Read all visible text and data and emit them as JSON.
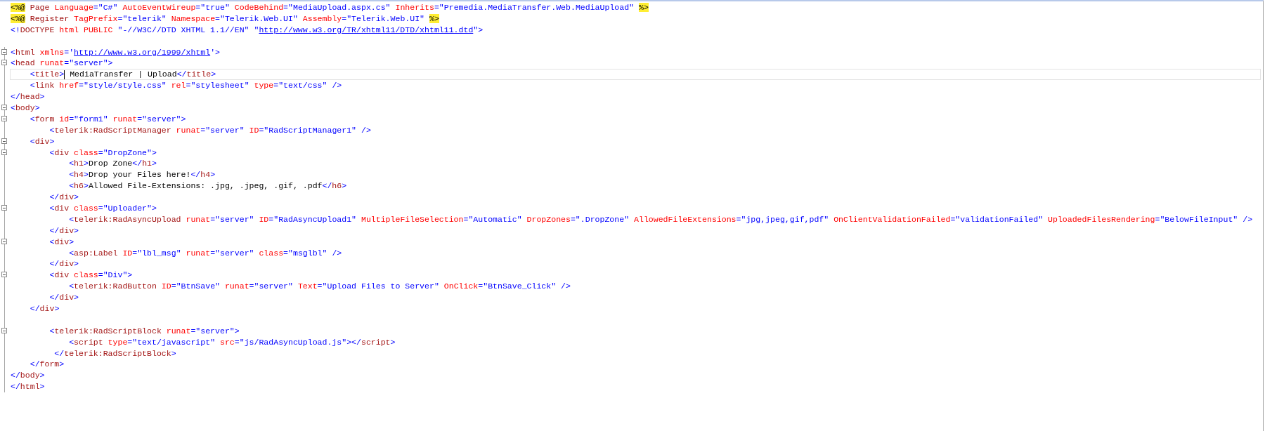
{
  "editor": {
    "lines": [
      {
        "in_block": false,
        "collapsible": false,
        "tokens": [
          {
            "kind": "directive",
            "text": "<%@"
          },
          {
            "kind": "tag",
            "text": " Page"
          },
          {
            "kind": "attr",
            "text": " Language"
          },
          {
            "kind": "value",
            "text": "=\"C#\""
          },
          {
            "kind": "attr",
            "text": " AutoEventWireup"
          },
          {
            "kind": "value",
            "text": "=\"true\""
          },
          {
            "kind": "attr",
            "text": " CodeBehind"
          },
          {
            "kind": "value",
            "text": "=\"MediaUpload.aspx.cs\""
          },
          {
            "kind": "attr",
            "text": " Inherits"
          },
          {
            "kind": "value",
            "text": "=\"Premedia.MediaTransfer.Web.MediaUpload\" "
          },
          {
            "kind": "directive",
            "text": "%>"
          }
        ]
      },
      {
        "in_block": false,
        "collapsible": false,
        "tokens": [
          {
            "kind": "directive",
            "text": "<%@"
          },
          {
            "kind": "tag",
            "text": " Register"
          },
          {
            "kind": "attr",
            "text": " TagPrefix"
          },
          {
            "kind": "value",
            "text": "=\"telerik\""
          },
          {
            "kind": "attr",
            "text": " Namespace"
          },
          {
            "kind": "value",
            "text": "=\"Telerik.Web.UI\""
          },
          {
            "kind": "attr",
            "text": " Assembly"
          },
          {
            "kind": "value",
            "text": "=\"Telerik.Web.UI\" "
          },
          {
            "kind": "directive",
            "text": "%>"
          }
        ]
      },
      {
        "in_block": false,
        "collapsible": false,
        "tokens": [
          {
            "kind": "delim",
            "text": "<!"
          },
          {
            "kind": "tag",
            "text": "DOCTYPE"
          },
          {
            "kind": "attr",
            "text": " html PUBLIC"
          },
          {
            "kind": "value",
            "text": " \"-//W3C//DTD XHTML 1.1//EN\" \""
          },
          {
            "kind": "link",
            "text": "http://www.w3.org/TR/xhtml11/DTD/xhtml11.dtd"
          },
          {
            "kind": "value",
            "text": "\""
          },
          {
            "kind": "delim",
            "text": ">"
          }
        ]
      },
      {
        "in_block": false,
        "collapsible": false
      },
      {
        "in_block": true,
        "collapsible": true,
        "tokens": [
          {
            "kind": "delim",
            "text": "<"
          },
          {
            "kind": "tag",
            "text": "html"
          },
          {
            "kind": "attr",
            "text": " xmlns"
          },
          {
            "kind": "value",
            "text": "='"
          },
          {
            "kind": "link",
            "text": "http://www.w3.org/1999/xhtml"
          },
          {
            "kind": "value",
            "text": "'"
          },
          {
            "kind": "delim",
            "text": ">"
          }
        ]
      },
      {
        "in_block": true,
        "collapsible": true,
        "tokens": [
          {
            "kind": "delim",
            "text": "<"
          },
          {
            "kind": "tag",
            "text": "head"
          },
          {
            "kind": "attr",
            "text": " runat"
          },
          {
            "kind": "value",
            "text": "=\"server\""
          },
          {
            "kind": "delim",
            "text": ">"
          }
        ]
      },
      {
        "in_block": true,
        "collapsible": false,
        "current": true,
        "tokens": [
          {
            "kind": "delim",
            "text": "    <"
          },
          {
            "kind": "tag",
            "text": "title"
          },
          {
            "kind": "delim",
            "text": ">"
          },
          {
            "kind": "text",
            "text": " MediaTransfer | Upload"
          },
          {
            "kind": "delim",
            "text": "</"
          },
          {
            "kind": "tag",
            "text": "title"
          },
          {
            "kind": "delim",
            "text": ">"
          }
        ]
      },
      {
        "in_block": true,
        "collapsible": false,
        "tokens": [
          {
            "kind": "delim",
            "text": "    <"
          },
          {
            "kind": "tag",
            "text": "link"
          },
          {
            "kind": "attr",
            "text": " href"
          },
          {
            "kind": "value",
            "text": "=\"style/style.css\""
          },
          {
            "kind": "attr",
            "text": " rel"
          },
          {
            "kind": "value",
            "text": "=\"stylesheet\""
          },
          {
            "kind": "attr",
            "text": " type"
          },
          {
            "kind": "value",
            "text": "=\"text/css\""
          },
          {
            "kind": "delim",
            "text": " />"
          }
        ]
      },
      {
        "in_block": true,
        "collapsible": false,
        "tokens": [
          {
            "kind": "delim",
            "text": "</"
          },
          {
            "kind": "tag",
            "text": "head"
          },
          {
            "kind": "delim",
            "text": ">"
          }
        ]
      },
      {
        "in_block": true,
        "collapsible": true,
        "tokens": [
          {
            "kind": "delim",
            "text": "<"
          },
          {
            "kind": "tag",
            "text": "body"
          },
          {
            "kind": "delim",
            "text": ">"
          }
        ]
      },
      {
        "in_block": true,
        "collapsible": true,
        "tokens": [
          {
            "kind": "delim",
            "text": "    <"
          },
          {
            "kind": "tag",
            "text": "form"
          },
          {
            "kind": "attr",
            "text": " id"
          },
          {
            "kind": "value",
            "text": "=\"form1\""
          },
          {
            "kind": "attr",
            "text": " runat"
          },
          {
            "kind": "value",
            "text": "=\"server\""
          },
          {
            "kind": "delim",
            "text": ">"
          }
        ]
      },
      {
        "in_block": true,
        "collapsible": false,
        "tokens": [
          {
            "kind": "delim",
            "text": "        <"
          },
          {
            "kind": "tag",
            "text": "telerik:RadScriptManager"
          },
          {
            "kind": "attr",
            "text": " runat"
          },
          {
            "kind": "value",
            "text": "=\"server\""
          },
          {
            "kind": "attr",
            "text": " ID"
          },
          {
            "kind": "value",
            "text": "=\"RadScriptManager1\""
          },
          {
            "kind": "delim",
            "text": " />"
          }
        ]
      },
      {
        "in_block": true,
        "collapsible": true,
        "tokens": [
          {
            "kind": "delim",
            "text": "    <"
          },
          {
            "kind": "tag",
            "text": "div"
          },
          {
            "kind": "delim",
            "text": ">"
          }
        ]
      },
      {
        "in_block": true,
        "collapsible": true,
        "tokens": [
          {
            "kind": "delim",
            "text": "        <"
          },
          {
            "kind": "tag",
            "text": "div"
          },
          {
            "kind": "attr",
            "text": " class"
          },
          {
            "kind": "value",
            "text": "=\"DropZone\""
          },
          {
            "kind": "delim",
            "text": ">"
          }
        ]
      },
      {
        "in_block": true,
        "collapsible": false,
        "tokens": [
          {
            "kind": "delim",
            "text": "            <"
          },
          {
            "kind": "tag",
            "text": "h1"
          },
          {
            "kind": "delim",
            "text": ">"
          },
          {
            "kind": "text",
            "text": "Drop Zone"
          },
          {
            "kind": "delim",
            "text": "</"
          },
          {
            "kind": "tag",
            "text": "h1"
          },
          {
            "kind": "delim",
            "text": ">"
          }
        ]
      },
      {
        "in_block": true,
        "collapsible": false,
        "tokens": [
          {
            "kind": "delim",
            "text": "            <"
          },
          {
            "kind": "tag",
            "text": "h4"
          },
          {
            "kind": "delim",
            "text": ">"
          },
          {
            "kind": "text",
            "text": "Drop your Files here!"
          },
          {
            "kind": "delim",
            "text": "</"
          },
          {
            "kind": "tag",
            "text": "h4"
          },
          {
            "kind": "delim",
            "text": ">"
          }
        ]
      },
      {
        "in_block": true,
        "collapsible": false,
        "tokens": [
          {
            "kind": "delim",
            "text": "            <"
          },
          {
            "kind": "tag",
            "text": "h6"
          },
          {
            "kind": "delim",
            "text": ">"
          },
          {
            "kind": "text",
            "text": "Allowed File-Extensions: .jpg, .jpeg, .gif, .pdf"
          },
          {
            "kind": "delim",
            "text": "</"
          },
          {
            "kind": "tag",
            "text": "h6"
          },
          {
            "kind": "delim",
            "text": ">"
          }
        ]
      },
      {
        "in_block": true,
        "collapsible": false,
        "tokens": [
          {
            "kind": "delim",
            "text": "        </"
          },
          {
            "kind": "tag",
            "text": "div"
          },
          {
            "kind": "delim",
            "text": ">"
          }
        ]
      },
      {
        "in_block": true,
        "collapsible": true,
        "tokens": [
          {
            "kind": "delim",
            "text": "        <"
          },
          {
            "kind": "tag",
            "text": "div"
          },
          {
            "kind": "attr",
            "text": " class"
          },
          {
            "kind": "value",
            "text": "=\"Uploader\""
          },
          {
            "kind": "delim",
            "text": ">"
          }
        ]
      },
      {
        "in_block": true,
        "collapsible": false,
        "tokens": [
          {
            "kind": "delim",
            "text": "            <"
          },
          {
            "kind": "tag",
            "text": "telerik:RadAsyncUpload"
          },
          {
            "kind": "attr",
            "text": " runat"
          },
          {
            "kind": "value",
            "text": "=\"server\""
          },
          {
            "kind": "attr",
            "text": " ID"
          },
          {
            "kind": "value",
            "text": "=\"RadAsyncUpload1\""
          },
          {
            "kind": "attr",
            "text": " MultipleFileSelection"
          },
          {
            "kind": "value",
            "text": "=\"Automatic\""
          },
          {
            "kind": "attr",
            "text": " DropZones"
          },
          {
            "kind": "value",
            "text": "=\".DropZone\""
          },
          {
            "kind": "attr",
            "text": " AllowedFileExtensions"
          },
          {
            "kind": "value",
            "text": "=\"jpg,jpeg,gif,pdf\""
          },
          {
            "kind": "attr",
            "text": " OnClientValidationFailed"
          },
          {
            "kind": "value",
            "text": "=\"validationFailed\""
          },
          {
            "kind": "attr",
            "text": " UploadedFilesRendering"
          },
          {
            "kind": "value",
            "text": "=\"BelowFileInput\""
          },
          {
            "kind": "delim",
            "text": " />"
          }
        ]
      },
      {
        "in_block": true,
        "collapsible": false,
        "tokens": [
          {
            "kind": "delim",
            "text": "        </"
          },
          {
            "kind": "tag",
            "text": "div"
          },
          {
            "kind": "delim",
            "text": ">"
          }
        ]
      },
      {
        "in_block": true,
        "collapsible": true,
        "tokens": [
          {
            "kind": "delim",
            "text": "        <"
          },
          {
            "kind": "tag",
            "text": "div"
          },
          {
            "kind": "delim",
            "text": ">"
          }
        ]
      },
      {
        "in_block": true,
        "collapsible": false,
        "tokens": [
          {
            "kind": "delim",
            "text": "            <"
          },
          {
            "kind": "tag",
            "text": "asp:Label"
          },
          {
            "kind": "attr",
            "text": " ID"
          },
          {
            "kind": "value",
            "text": "=\"lbl_msg\""
          },
          {
            "kind": "attr",
            "text": " runat"
          },
          {
            "kind": "value",
            "text": "=\"server\""
          },
          {
            "kind": "attr",
            "text": " class"
          },
          {
            "kind": "value",
            "text": "=\"msglbl\""
          },
          {
            "kind": "delim",
            "text": " />"
          }
        ]
      },
      {
        "in_block": true,
        "collapsible": false,
        "tokens": [
          {
            "kind": "delim",
            "text": "        </"
          },
          {
            "kind": "tag",
            "text": "div"
          },
          {
            "kind": "delim",
            "text": ">"
          }
        ]
      },
      {
        "in_block": true,
        "collapsible": true,
        "tokens": [
          {
            "kind": "delim",
            "text": "        <"
          },
          {
            "kind": "tag",
            "text": "div"
          },
          {
            "kind": "attr",
            "text": " class"
          },
          {
            "kind": "value",
            "text": "=\"Div\""
          },
          {
            "kind": "delim",
            "text": ">"
          }
        ]
      },
      {
        "in_block": true,
        "collapsible": false,
        "tokens": [
          {
            "kind": "delim",
            "text": "            <"
          },
          {
            "kind": "tag",
            "text": "telerik:RadButton"
          },
          {
            "kind": "attr",
            "text": " ID"
          },
          {
            "kind": "value",
            "text": "=\"BtnSave\""
          },
          {
            "kind": "attr",
            "text": " runat"
          },
          {
            "kind": "value",
            "text": "=\"server\""
          },
          {
            "kind": "attr",
            "text": " Text"
          },
          {
            "kind": "value",
            "text": "=\"Upload Files to Server\""
          },
          {
            "kind": "attr",
            "text": " OnClick"
          },
          {
            "kind": "value",
            "text": "=\"BtnSave_Click\""
          },
          {
            "kind": "delim",
            "text": " />"
          }
        ]
      },
      {
        "in_block": true,
        "collapsible": false,
        "tokens": [
          {
            "kind": "delim",
            "text": "        </"
          },
          {
            "kind": "tag",
            "text": "div"
          },
          {
            "kind": "delim",
            "text": ">"
          }
        ]
      },
      {
        "in_block": true,
        "collapsible": false,
        "tokens": [
          {
            "kind": "delim",
            "text": "    </"
          },
          {
            "kind": "tag",
            "text": "div"
          },
          {
            "kind": "delim",
            "text": ">"
          }
        ]
      },
      {
        "in_block": true,
        "collapsible": false
      },
      {
        "in_block": true,
        "collapsible": true,
        "tokens": [
          {
            "kind": "delim",
            "text": "        <"
          },
          {
            "kind": "tag",
            "text": "telerik:RadScriptBlock"
          },
          {
            "kind": "attr",
            "text": " runat"
          },
          {
            "kind": "value",
            "text": "=\"server\""
          },
          {
            "kind": "delim",
            "text": ">"
          }
        ]
      },
      {
        "in_block": true,
        "collapsible": false,
        "tokens": [
          {
            "kind": "delim",
            "text": "            <"
          },
          {
            "kind": "tag",
            "text": "script"
          },
          {
            "kind": "attr",
            "text": " type"
          },
          {
            "kind": "value",
            "text": "=\"text/javascript\""
          },
          {
            "kind": "attr",
            "text": " src"
          },
          {
            "kind": "value",
            "text": "=\"js/RadAsyncUpload.js\""
          },
          {
            "kind": "delim",
            "text": "></"
          },
          {
            "kind": "tag",
            "text": "script"
          },
          {
            "kind": "delim",
            "text": ">"
          }
        ]
      },
      {
        "in_block": true,
        "collapsible": false,
        "tokens": [
          {
            "kind": "delim",
            "text": "         </"
          },
          {
            "kind": "tag",
            "text": "telerik:RadScriptBlock"
          },
          {
            "kind": "delim",
            "text": ">"
          }
        ]
      },
      {
        "in_block": true,
        "collapsible": false,
        "tokens": [
          {
            "kind": "delim",
            "text": "    </"
          },
          {
            "kind": "tag",
            "text": "form"
          },
          {
            "kind": "delim",
            "text": ">"
          }
        ]
      },
      {
        "in_block": true,
        "collapsible": false,
        "tokens": [
          {
            "kind": "delim",
            "text": "</"
          },
          {
            "kind": "tag",
            "text": "body"
          },
          {
            "kind": "delim",
            "text": ">"
          }
        ]
      },
      {
        "in_block": true,
        "collapsible": false,
        "tokens": [
          {
            "kind": "delim",
            "text": "</"
          },
          {
            "kind": "tag",
            "text": "html"
          },
          {
            "kind": "delim",
            "text": ">"
          }
        ]
      }
    ]
  }
}
